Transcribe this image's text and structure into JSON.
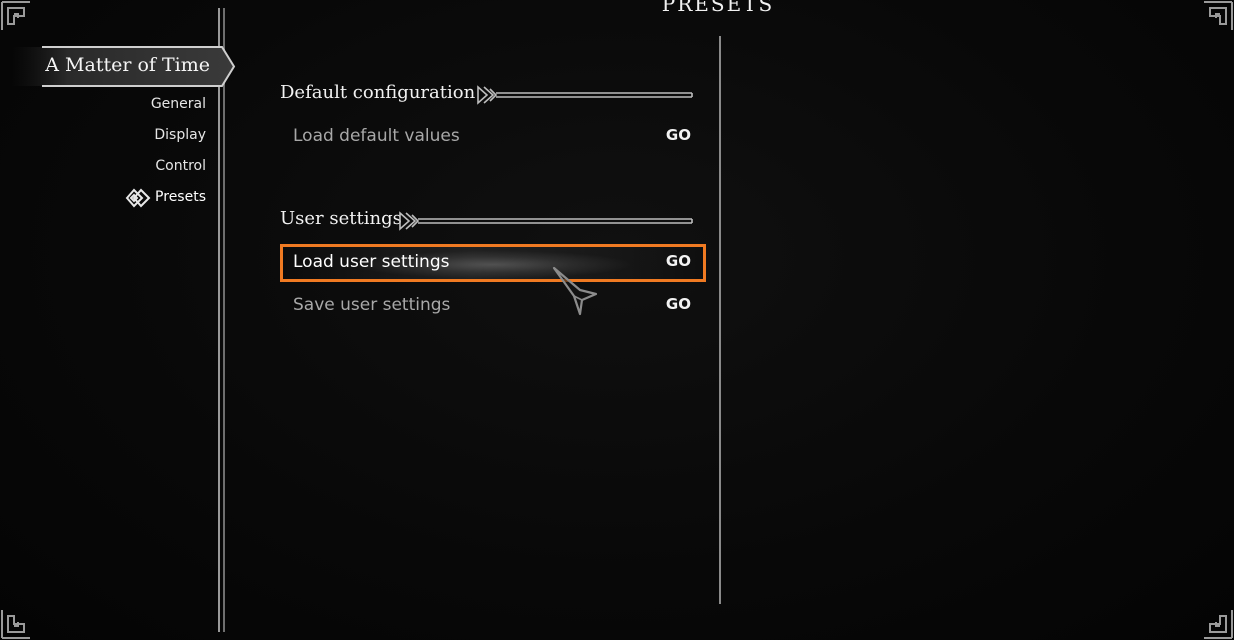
{
  "header": {
    "title": "PRESETS"
  },
  "sidebar": {
    "mod_name": "A Matter of Time",
    "items": [
      {
        "label": "General"
      },
      {
        "label": "Display"
      },
      {
        "label": "Control"
      },
      {
        "label": "Presets",
        "selected": true,
        "icon": "knot-icon"
      }
    ]
  },
  "sections": [
    {
      "title": "Default configuration",
      "options": [
        {
          "label": "Load default values",
          "action": "GO"
        }
      ]
    },
    {
      "title": "User settings",
      "options": [
        {
          "label": "Load user settings",
          "action": "GO",
          "selected": true
        },
        {
          "label": "Save user settings",
          "action": "GO"
        }
      ]
    }
  ],
  "colors": {
    "highlight": "#f07a22",
    "background": "#070707",
    "text": "#e8e8e8",
    "muted_text": "#a8a8a8"
  }
}
